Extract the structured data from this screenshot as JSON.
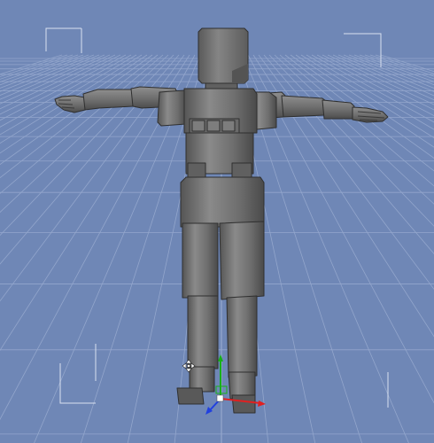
{
  "viewport": {
    "background": "#6f87b6",
    "grid_color": "#93a6cc",
    "grid_major_color": "#a9b9d8",
    "bracket_color": "#d9e1f0"
  },
  "model": {
    "body_color": "#737373",
    "shadow_color": "#4a4a4a",
    "highlight_color": "#9a9a9a",
    "outline_color": "#2f2f2f",
    "pose": "T-pose"
  },
  "gizmo": {
    "axis_x_color": "#e02020",
    "axis_y_color": "#18b018",
    "axis_z_color": "#2040e0",
    "center_color": "#ffffff"
  },
  "icons": {
    "viewport_cursor": "move-cursor-icon"
  }
}
